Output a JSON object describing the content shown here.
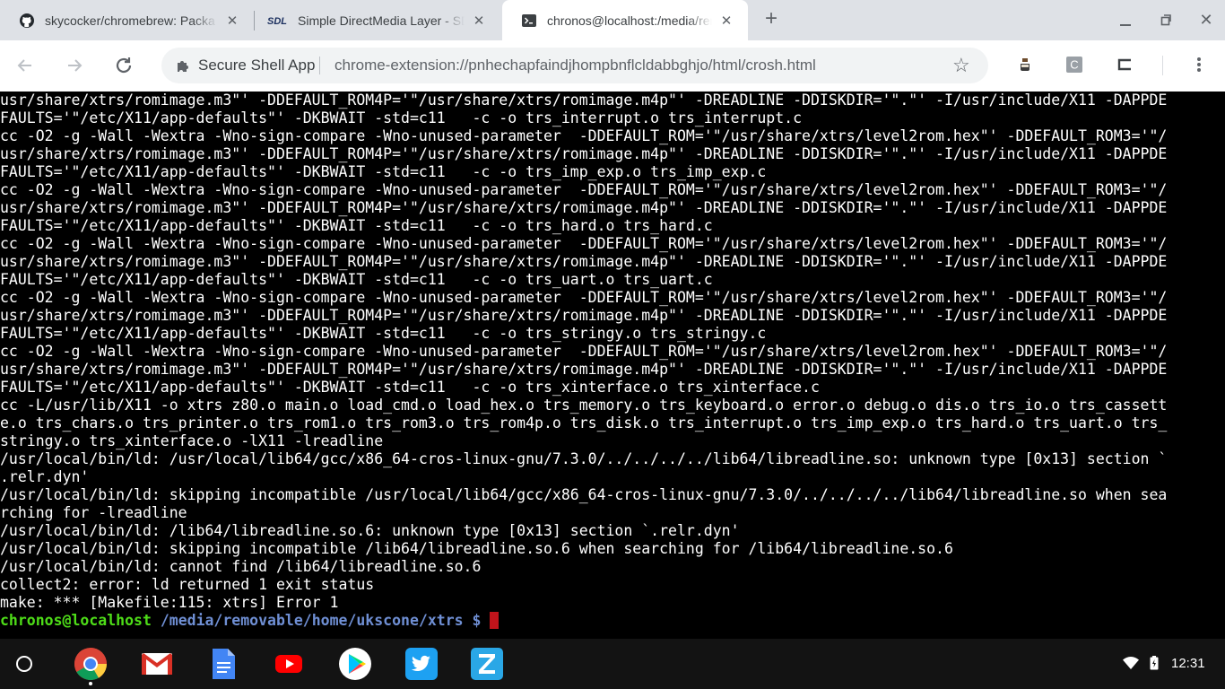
{
  "tabs": [
    {
      "title": "skycocker/chromebrew: Packa",
      "icon": "github-icon"
    },
    {
      "title": "Simple DirectMedia Layer - SDL",
      "icon": "sdl-icon"
    },
    {
      "title": "chronos@localhost:/media/removable",
      "icon": "terminal-icon"
    }
  ],
  "toolbar": {
    "ext_name": "Secure Shell App",
    "url": "chrome-extension://pnhechapfaindjhompbnflcldabbghjo/html/crosh.html",
    "ext_badge": "C"
  },
  "terminal": {
    "lines": [
      "usr/share/xtrs/romimage.m3\"' -DDEFAULT_ROM4P='\"/usr/share/xtrs/romimage.m4p\"' -DREADLINE -DDISKDIR='\".\"' -I/usr/include/X11 -DAPPDE",
      "FAULTS='\"/etc/X11/app-defaults\"' -DKBWAIT -std=c11   -c -o trs_interrupt.o trs_interrupt.c",
      "cc -O2 -g -Wall -Wextra -Wno-sign-compare -Wno-unused-parameter  -DDEFAULT_ROM='\"/usr/share/xtrs/level2rom.hex\"' -DDEFAULT_ROM3='\"/",
      "usr/share/xtrs/romimage.m3\"' -DDEFAULT_ROM4P='\"/usr/share/xtrs/romimage.m4p\"' -DREADLINE -DDISKDIR='\".\"' -I/usr/include/X11 -DAPPDE",
      "FAULTS='\"/etc/X11/app-defaults\"' -DKBWAIT -std=c11   -c -o trs_imp_exp.o trs_imp_exp.c",
      "cc -O2 -g -Wall -Wextra -Wno-sign-compare -Wno-unused-parameter  -DDEFAULT_ROM='\"/usr/share/xtrs/level2rom.hex\"' -DDEFAULT_ROM3='\"/",
      "usr/share/xtrs/romimage.m3\"' -DDEFAULT_ROM4P='\"/usr/share/xtrs/romimage.m4p\"' -DREADLINE -DDISKDIR='\".\"' -I/usr/include/X11 -DAPPDE",
      "FAULTS='\"/etc/X11/app-defaults\"' -DKBWAIT -std=c11   -c -o trs_hard.o trs_hard.c",
      "cc -O2 -g -Wall -Wextra -Wno-sign-compare -Wno-unused-parameter  -DDEFAULT_ROM='\"/usr/share/xtrs/level2rom.hex\"' -DDEFAULT_ROM3='\"/",
      "usr/share/xtrs/romimage.m3\"' -DDEFAULT_ROM4P='\"/usr/share/xtrs/romimage.m4p\"' -DREADLINE -DDISKDIR='\".\"' -I/usr/include/X11 -DAPPDE",
      "FAULTS='\"/etc/X11/app-defaults\"' -DKBWAIT -std=c11   -c -o trs_uart.o trs_uart.c",
      "cc -O2 -g -Wall -Wextra -Wno-sign-compare -Wno-unused-parameter  -DDEFAULT_ROM='\"/usr/share/xtrs/level2rom.hex\"' -DDEFAULT_ROM3='\"/",
      "usr/share/xtrs/romimage.m3\"' -DDEFAULT_ROM4P='\"/usr/share/xtrs/romimage.m4p\"' -DREADLINE -DDISKDIR='\".\"' -I/usr/include/X11 -DAPPDE",
      "FAULTS='\"/etc/X11/app-defaults\"' -DKBWAIT -std=c11   -c -o trs_stringy.o trs_stringy.c",
      "cc -O2 -g -Wall -Wextra -Wno-sign-compare -Wno-unused-parameter  -DDEFAULT_ROM='\"/usr/share/xtrs/level2rom.hex\"' -DDEFAULT_ROM3='\"/",
      "usr/share/xtrs/romimage.m3\"' -DDEFAULT_ROM4P='\"/usr/share/xtrs/romimage.m4p\"' -DREADLINE -DDISKDIR='\".\"' -I/usr/include/X11 -DAPPDE",
      "FAULTS='\"/etc/X11/app-defaults\"' -DKBWAIT -std=c11   -c -o trs_xinterface.o trs_xinterface.c",
      "cc -L/usr/lib/X11 -o xtrs z80.o main.o load_cmd.o load_hex.o trs_memory.o trs_keyboard.o error.o debug.o dis.o trs_io.o trs_cassett",
      "e.o trs_chars.o trs_printer.o trs_rom1.o trs_rom3.o trs_rom4p.o trs_disk.o trs_interrupt.o trs_imp_exp.o trs_hard.o trs_uart.o trs_",
      "stringy.o trs_xinterface.o -lX11 -lreadline",
      "/usr/local/bin/ld: /usr/local/lib64/gcc/x86_64-cros-linux-gnu/7.3.0/../../../../lib64/libreadline.so: unknown type [0x13] section `",
      ".relr.dyn'",
      "/usr/local/bin/ld: skipping incompatible /usr/local/lib64/gcc/x86_64-cros-linux-gnu/7.3.0/../../../../lib64/libreadline.so when sea",
      "rching for -lreadline",
      "/usr/local/bin/ld: /lib64/libreadline.so.6: unknown type [0x13] section `.relr.dyn'",
      "/usr/local/bin/ld: skipping incompatible /lib64/libreadline.so.6 when searching for /lib64/libreadline.so.6",
      "/usr/local/bin/ld: cannot find /lib64/libreadline.so.6",
      "collect2: error: ld returned 1 exit status",
      "make: *** [Makefile:115: xtrs] Error 1"
    ],
    "prompt_user": "chronos@localhost",
    "prompt_path": "/media/removable/home/ukscone/xtrs",
    "prompt_symbol": "$"
  },
  "shelf": {
    "apps": [
      "chrome-icon",
      "gmail-icon",
      "docs-icon",
      "youtube-icon",
      "play-store-icon",
      "twitter-icon",
      "zoom-icon"
    ],
    "time": "12:31"
  },
  "colors": {
    "prompt_user": "#4edd18",
    "prompt_path": "#6f8fd4",
    "cursor": "#c0141b"
  }
}
